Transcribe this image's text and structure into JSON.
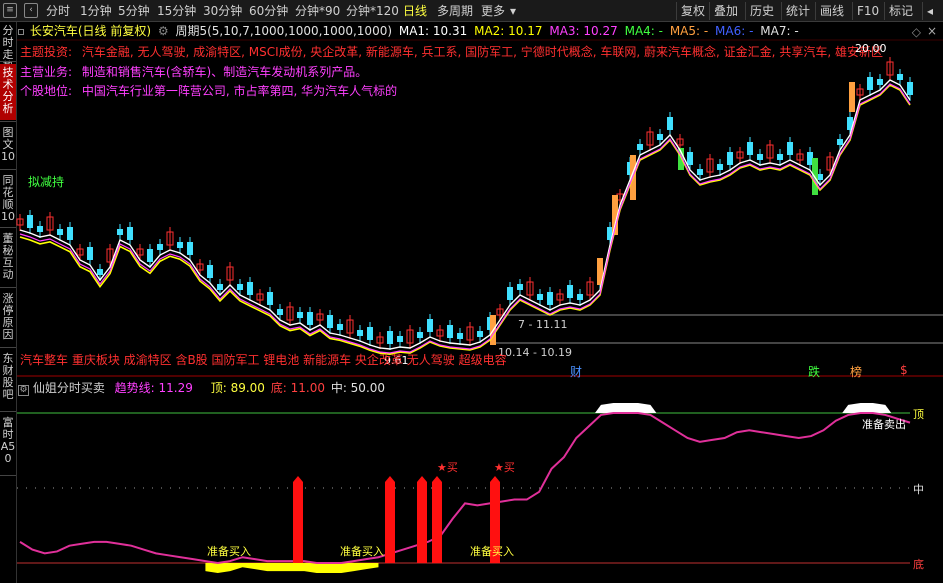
{
  "toolbar": {
    "left_items": [
      "分时",
      "1分钟",
      "5分钟",
      "15分钟",
      "30分钟",
      "60分钟",
      "分钟*90",
      "分钟*120",
      "日线",
      "多周期",
      "更多"
    ],
    "active_item": "日线",
    "right_items": [
      "复权",
      "叠加",
      "历史",
      "统计",
      "画线",
      "F10",
      "标记"
    ]
  },
  "sidebar": {
    "tabs": [
      "分时走势",
      "技术分析",
      "图文10",
      "同花顺10",
      "董秘互动",
      "涨停原因",
      "东财股吧",
      "富时A50"
    ],
    "active_tab": "技术分析"
  },
  "infoline": {
    "stock": "长安汽车(日线 前复权)",
    "period": "周期5(5,10,7,1000,1000,1000,1000)",
    "ma1": "MA1: 10.31",
    "ma2": "MA2: 10.17",
    "ma3": "MA3: 10.27",
    "ma4": "MA4: -",
    "ma5": "MA5: -",
    "ma6": "MA6: -",
    "ma7": "MA7: -",
    "colors": {
      "stock": "#ffff40",
      "period": "#e0e0e0",
      "ma1": "#ffffff",
      "ma2": "#ffff00",
      "ma3": "#ff40ff",
      "ma4": "#40ff40",
      "ma5": "#ffa040",
      "ma6": "#4060ff",
      "ma7": "#e0e0e0"
    }
  },
  "info": {
    "theme_label": "主题投资:",
    "theme_text": "汽车金融, 无人驾驶, 成渝特区, MSCI成份, 央企改革, 新能源车, 兵工系, 国防军工, 宁德时代概念, 车联网, 蔚来汽车概念, 证金汇金, 共享汽车, 雄安新区",
    "business_label": "主营业务:",
    "business_text": "制造和销售汽车(含轿车)、制造汽车发动机系列产品。",
    "position_label": "个股地位:",
    "position_text": "中国汽车行业第一阵营公司, 市占率第四, 华为汽车人气标的"
  },
  "chart_annotations": {
    "reduce_label": "拟减持",
    "price_high": "20.00",
    "price_low": "9.61",
    "range1": "7 - 11.11",
    "range2": "10.14 - 10.19",
    "sector_tags": "汽车整车 重庆板块 成渝特区 含B股 国防军工 锂电池 新能源车 央企改革 无人驾驶 超级电容",
    "event_markers": [
      {
        "text": "财",
        "color": "#4a90ff"
      },
      {
        "text": "跌",
        "color": "#40ff40"
      },
      {
        "text": "榜",
        "color": "#ffa040"
      },
      {
        "text": "$",
        "color": "#ff4040"
      }
    ]
  },
  "subchart": {
    "title": "仙姐分时买卖",
    "trend_label": "趋势线: 11.29",
    "top_label": "顶: 89.00",
    "bottom_label": "底: 11.00",
    "mid_label": "中: 50.00",
    "right_top": "顶",
    "right_mid": "中",
    "right_bottom": "底",
    "buy_labels": [
      "准备买入",
      "准备买入",
      "准备买入"
    ],
    "sell_label": "准备卖出",
    "star_labels": [
      "★买",
      "★买"
    ]
  },
  "chart_data": {
    "type": "line",
    "title": "仙姐分时买卖",
    "series": [
      {
        "name": "趋势线",
        "values": [
          22,
          18,
          16,
          17,
          20,
          21,
          22,
          22,
          21,
          20,
          18,
          16,
          15,
          14,
          13,
          12,
          11,
          12,
          14,
          13,
          12,
          12,
          12,
          12,
          11,
          11,
          11,
          12,
          13,
          14,
          16,
          18,
          20,
          22,
          25,
          34,
          42,
          41,
          42,
          43,
          44,
          44,
          48,
          60,
          66,
          76,
          82,
          88,
          89,
          89,
          89,
          88,
          84,
          80,
          76,
          74,
          75,
          76,
          79,
          80,
          79,
          78,
          77,
          76,
          77,
          80,
          85,
          88,
          89,
          89,
          88,
          86,
          84
        ]
      }
    ],
    "ylim": [
      0,
      100
    ],
    "reference_lines": {
      "top": 89,
      "mid": 50,
      "bottom": 11
    }
  }
}
